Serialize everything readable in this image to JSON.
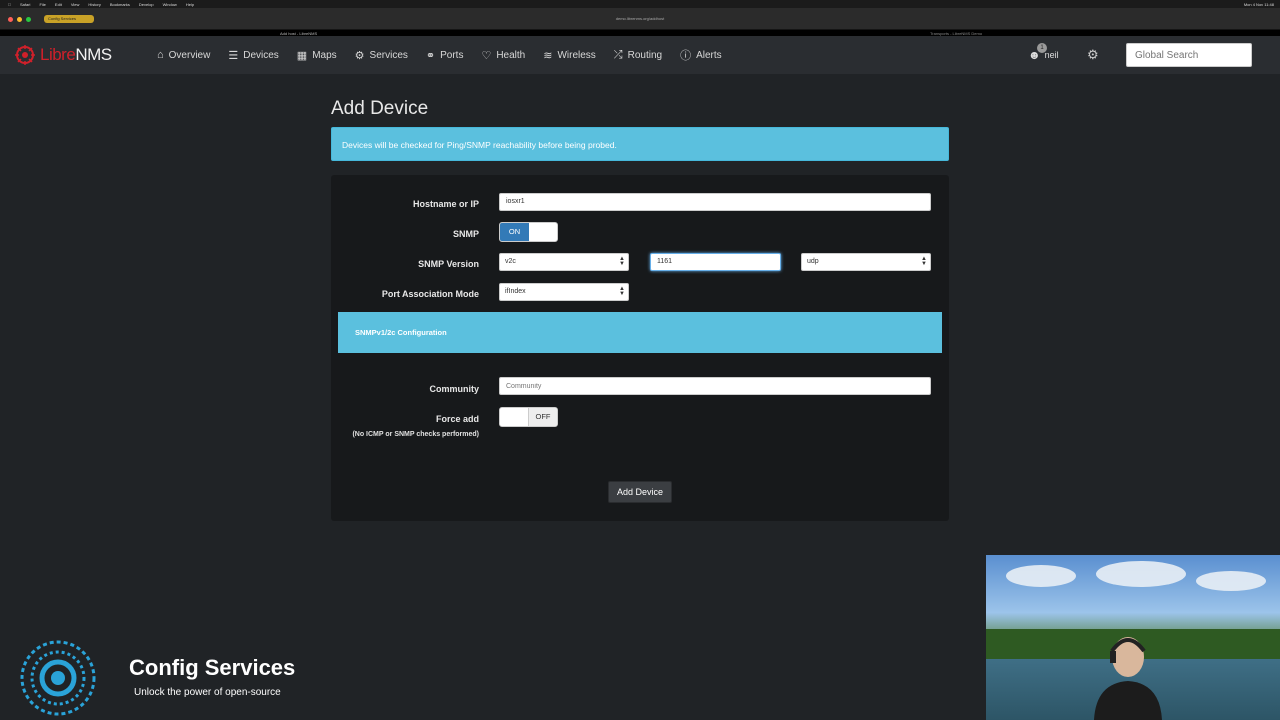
{
  "browser": {
    "tab_title": "Add host - LibreNMS",
    "second_tab_title": "Transports - LibreNMS Demo",
    "url": "demo.librenms.org/addhost",
    "pill_label": "Config Services",
    "menubar": {
      "app": "Safari",
      "items": [
        "File",
        "Edit",
        "View",
        "History",
        "Bookmarks",
        "Develop",
        "Window",
        "Help"
      ],
      "clock": "Mon 4 Nov 11:48"
    }
  },
  "navbar": {
    "brand_part1": "Libre",
    "brand_part2": "NMS",
    "items": [
      {
        "label": "Overview",
        "icon": "home-icon"
      },
      {
        "label": "Devices",
        "icon": "server-icon"
      },
      {
        "label": "Maps",
        "icon": "map-icon"
      },
      {
        "label": "Services",
        "icon": "cogs-icon"
      },
      {
        "label": "Ports",
        "icon": "link-icon"
      },
      {
        "label": "Health",
        "icon": "heartbeat-icon"
      },
      {
        "label": "Wireless",
        "icon": "wifi-icon"
      },
      {
        "label": "Routing",
        "icon": "random-icon"
      },
      {
        "label": "Alerts",
        "icon": "exclamation-circle-icon"
      }
    ],
    "user": {
      "name": "neil",
      "badge": "1"
    },
    "search_placeholder": "Global Search"
  },
  "page": {
    "title": "Add Device",
    "alert": "Devices will be checked for Ping/SNMP reachability before being probed.",
    "form": {
      "hostname_label": "Hostname or IP",
      "hostname_value": "iosxr1",
      "snmp_label": "SNMP",
      "snmp_toggle": "ON",
      "snmp_version_label": "SNMP Version",
      "snmp_version_value": "v2c",
      "port_value": "1161",
      "transport_value": "udp",
      "port_assoc_label": "Port Association Mode",
      "port_assoc_value": "ifIndex",
      "subsection_title": "SNMPv1/2c Configuration",
      "community_label": "Community",
      "community_placeholder": "Community",
      "force_add_label": "Force add",
      "force_add_note": "(No ICMP or SNMP checks performed)",
      "force_add_toggle": "OFF",
      "submit_label": "Add Device"
    }
  },
  "overlay": {
    "brand_name": "Config Services",
    "tagline": "Unlock the power of open-source"
  },
  "colors": {
    "navbar_bg": "#2a2d31",
    "page_bg": "#202326",
    "panel_bg": "#17191b",
    "info": "#5bc0de",
    "primary": "#337ab7",
    "brand_red": "#d0202a"
  }
}
